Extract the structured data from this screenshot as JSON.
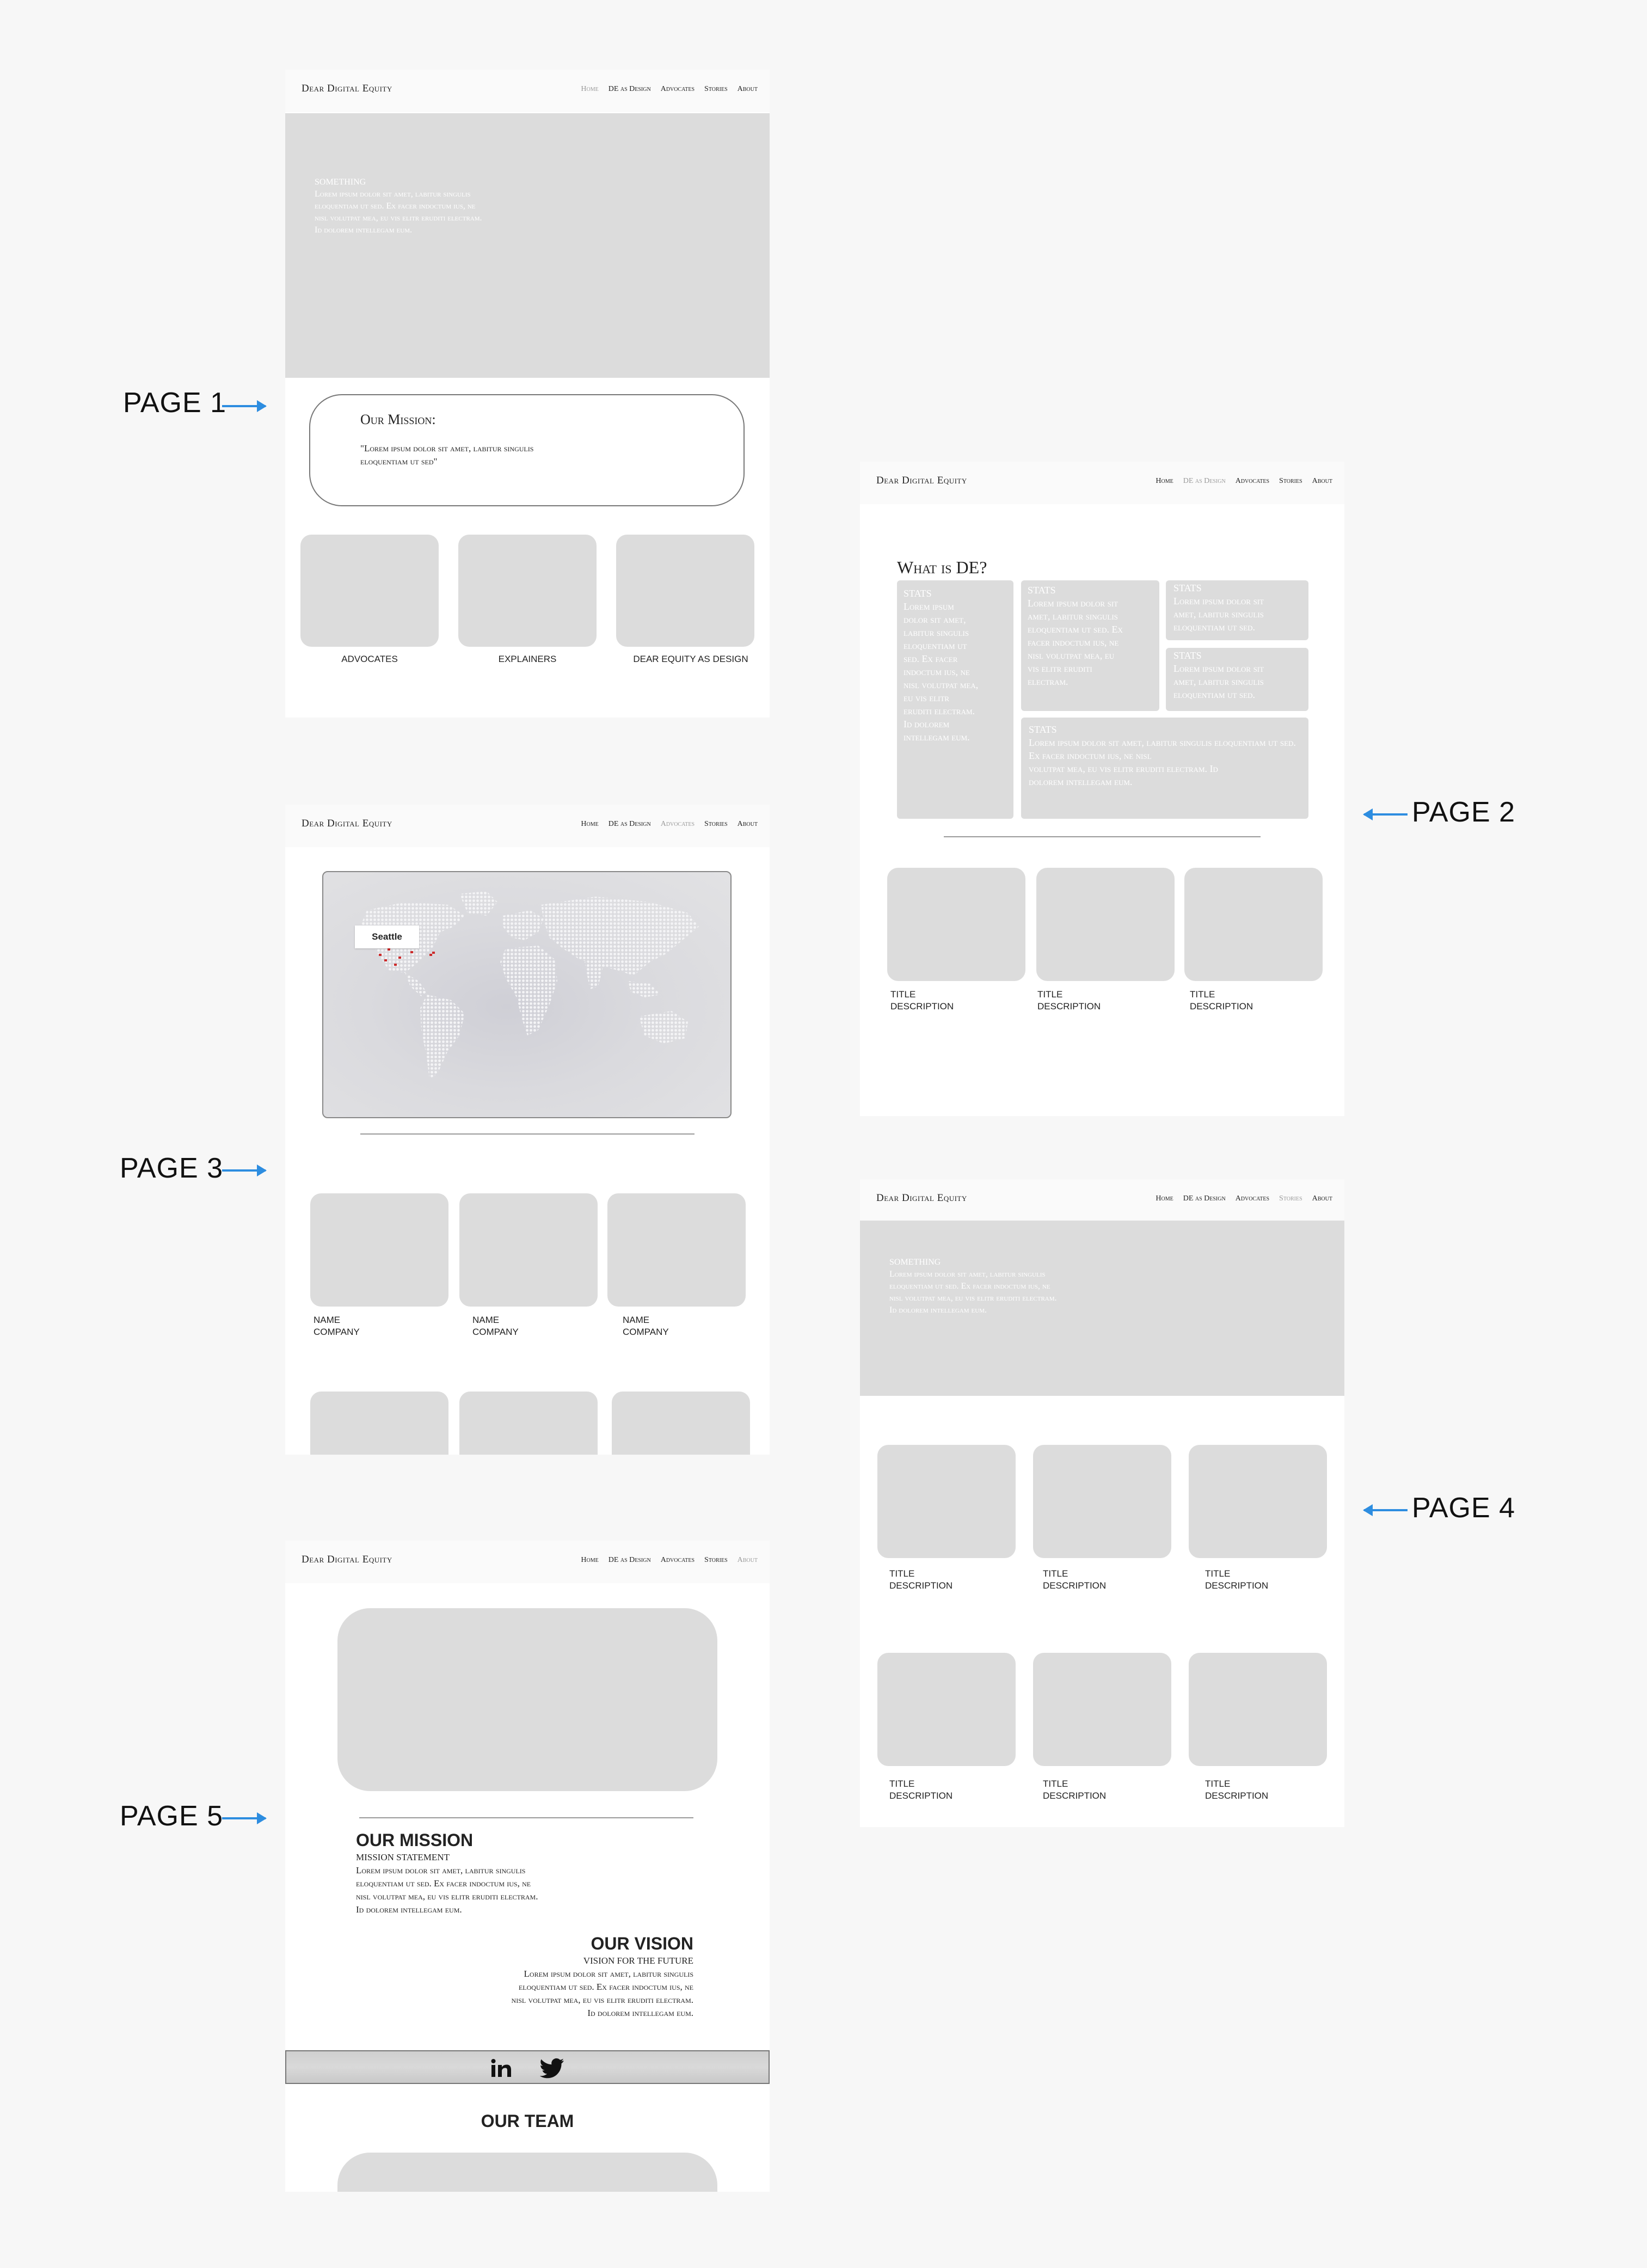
{
  "brand": "Dear Digital Equity",
  "nav": [
    "Home",
    "DE as Design",
    "Advocates",
    "Stories",
    "About"
  ],
  "labels": {
    "p1": "PAGE 1",
    "p2": "PAGE 2",
    "p3": "PAGE 3",
    "p4": "PAGE 4",
    "p5": "PAGE 5"
  },
  "page1": {
    "hero_heading": "SOMETHING",
    "hero_lines": [
      "Lorem ipsum dolor sit amet, labitur singulis",
      "eloquentiam ut sed. Ex facer indoctum ius, ne",
      "nisl volutpat mea, eu vis elitr eruditi electram.",
      "Id dolorem intellegam eum."
    ],
    "mission_title": "Our Mission:",
    "mission_lines": [
      "\"Lorem ipsum dolor sit amet, labitur singulis",
      "eloquentiam ut sed\""
    ],
    "cards": [
      "ADVOCATES",
      "EXPLAINERS",
      "DEAR EQUITY AS DESIGN"
    ]
  },
  "page2": {
    "title": "What is DE?",
    "stats_label": "STATS",
    "stat_left": [
      "Lorem ipsum",
      "dolor sit amet,",
      "labitur singulis",
      "eloquentiam ut",
      "sed. Ex facer",
      "indoctum ius, ne",
      "nisl volutpat mea,",
      "eu vis elitr",
      "eruditi electram.",
      "Id dolorem",
      "intellegam eum."
    ],
    "stat_mid": [
      "Lorem ipsum dolor sit",
      "amet, labitur singulis",
      "eloquentiam ut sed. Ex",
      "facer indoctum ius, ne",
      "nisl volutpat mea, eu",
      "vis elitr eruditi",
      "electram."
    ],
    "stat_small": [
      "Lorem ipsum dolor sit",
      "amet, labitur singulis",
      "eloquentiam ut sed."
    ],
    "stat_wide": [
      "Lorem ipsum dolor sit amet, labitur singulis eloquentiam ut sed. Ex facer indoctum ius, ne nisl",
      "volutpat mea, eu vis elitr eruditi electram. Id",
      "dolorem intellegam eum."
    ],
    "card_title": "TITLE",
    "card_desc": "DESCRIPTION"
  },
  "page3": {
    "map_label": "Seattle",
    "name": "NAME",
    "company": "COMPANY",
    "marker_color": "#cc2a2a"
  },
  "page4": {
    "hero_heading": "SOMETHING",
    "hero_lines": [
      "Lorem ipsum dolor sit amet, labitur singulis",
      "eloquentiam ut sed. Ex facer indoctum ius, ne",
      "nisl volutpat mea, eu vis elitr eruditi electram.",
      "Id dolorem intellegam eum."
    ],
    "card_title": "TITLE",
    "card_desc": "DESCRIPTION"
  },
  "page5": {
    "mission_heading": "OUR MISSION",
    "mission_sub": "MISSION STATEMENT",
    "mission_lines": [
      "Lorem ipsum dolor sit amet, labitur singulis",
      "eloquentiam ut sed. Ex facer indoctum ius, ne",
      "nisl volutpat mea, eu vis elitr eruditi electram.",
      "Id dolorem intellegam eum."
    ],
    "vision_heading": "OUR VISION",
    "vision_sub": "VISION FOR THE FUTURE",
    "vision_lines": [
      "Lorem ipsum dolor sit amet, labitur singulis",
      "eloquentiam ut sed. Ex facer indoctum ius, ne",
      "nisl volutpat mea, eu vis elitr eruditi electram.",
      "Id dolorem intellegam eum."
    ],
    "team_heading": "OUR TEAM",
    "social": [
      "linkedin-icon",
      "twitter-icon"
    ]
  },
  "colors": {
    "accent_arrow": "#2d8de0",
    "placeholder": "#dcdcdc"
  }
}
